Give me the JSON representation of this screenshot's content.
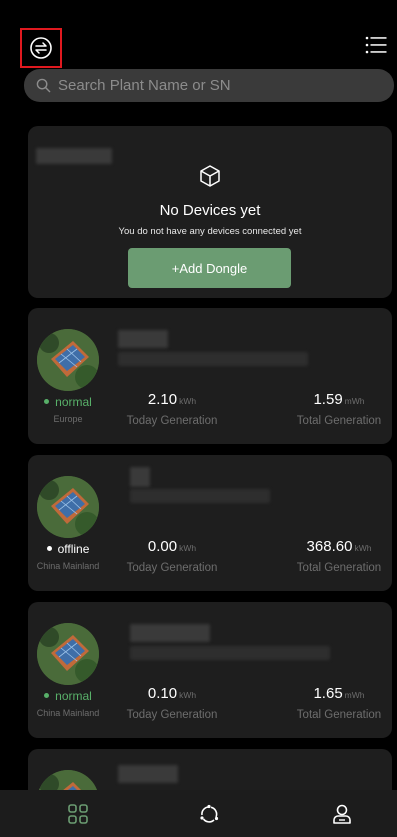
{
  "header": {
    "switch_icon": "switch-arrows-icon",
    "menu_icon": "list-menu-icon"
  },
  "search": {
    "placeholder": "Search Plant Name or SN",
    "icon": "search-icon"
  },
  "empty_card": {
    "icon": "cube-icon",
    "title": "No Devices yet",
    "subtitle": "You do not have any devices connected yet",
    "button_label": "+Add Dongle"
  },
  "plants": [
    {
      "status": "normal",
      "region": "Europe",
      "today_value": "2.10",
      "today_unit": "kWh",
      "today_label": "Today Generation",
      "total_value": "1.59",
      "total_unit": "mWh",
      "total_label": "Total Generation"
    },
    {
      "status": "offline",
      "region": "China Mainland",
      "today_value": "0.00",
      "today_unit": "kWh",
      "today_label": "Today Generation",
      "total_value": "368.60",
      "total_unit": "kWh",
      "total_label": "Total Generation"
    },
    {
      "status": "normal",
      "region": "China Mainland",
      "today_value": "0.10",
      "today_unit": "kWh",
      "today_label": "Today Generation",
      "total_value": "1.65",
      "total_unit": "mWh",
      "total_label": "Total Generation"
    }
  ],
  "bottom_nav": {
    "items": [
      "grid-icon",
      "refresh-cycle-icon",
      "user-icon"
    ],
    "active_color": "#6b9c72"
  },
  "colors": {
    "accent": "#6b9c72",
    "status_normal": "#58b069",
    "highlight_box": "#e0191f"
  }
}
